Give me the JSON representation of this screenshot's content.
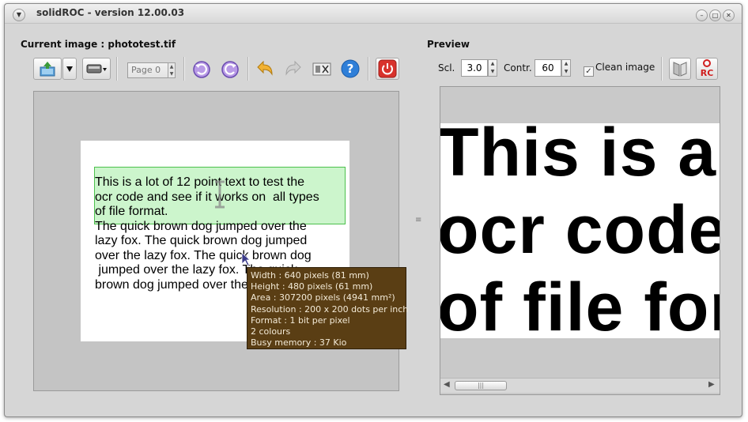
{
  "window": {
    "title": "solidROC - version 12.00.03"
  },
  "left": {
    "heading": "Current image : phototest.tif",
    "page_field": "Page 0",
    "icons": [
      "open-image-icon",
      "dropdown-arrow-icon",
      "scanner-icon",
      "rotate-left-icon",
      "rotate-right-icon",
      "undo-icon",
      "redo-icon",
      "crop-icon",
      "help-icon",
      "power-icon"
    ],
    "doc_lines": [
      "This is a lot of 12 point text to test the",
      "ocr code and see if it works on  all types",
      "of file format.",
      "The quick brown dog jumped over the",
      "lazy fox. The quick brown dog jumped",
      "over the lazy fox. The quick brown dog",
      " jumped over the lazy fox. The quick",
      "brown dog jumped over the lazy fox."
    ],
    "tooltip": [
      "Width : 640 pixels (81 mm)",
      "Height : 480 pixels (61 mm)",
      "Area : 307200 pixels (4941 mm²)",
      "Resolution : 200 x 200 dots per inch",
      "Format : 1 bit per pixel",
      "2 colours",
      "Busy memory : 37 Kio"
    ]
  },
  "right": {
    "heading": "Preview",
    "scl_label": "Scl.",
    "scl_value": "3.0",
    "contr_label": "Contr.",
    "contr_value": "60",
    "clean_label": "Clean image",
    "clean_checked": true,
    "preview_lines": [
      "This is a",
      "ocr code",
      "of file for"
    ],
    "ocr_button_text": "RC"
  },
  "colors": {
    "selection": "#7de67d",
    "tooltip_bg": "#5a3e14",
    "accent_blue": "#2f7fd8",
    "power_red": "#d8322c"
  }
}
